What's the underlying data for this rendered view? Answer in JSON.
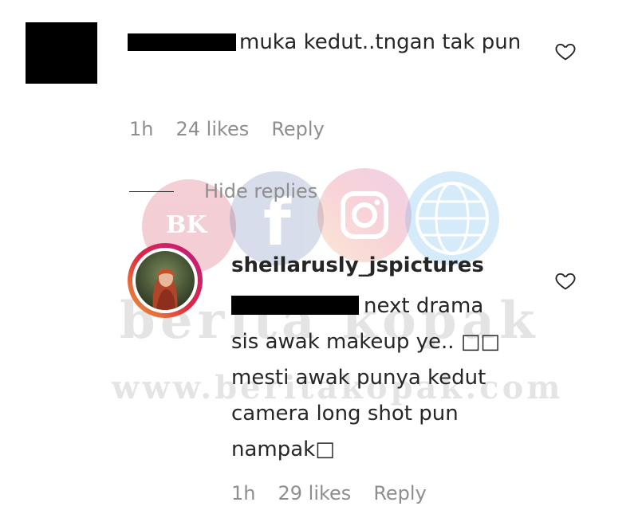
{
  "comment": {
    "text": "muka kedut..tngan tak pun",
    "time": "1h",
    "likes": "24 likes",
    "reply_label": "Reply"
  },
  "hide_replies_label": "Hide replies",
  "reply": {
    "username": "sheilarusly_jspictures",
    "text_lines": [
      "next drama",
      "sis awak makeup ye.. □□",
      "mesti awak punya kedut",
      "camera long shot pun",
      "nampak□"
    ],
    "time": "1h",
    "likes": "29 likes",
    "reply_label": "Reply"
  },
  "watermark": {
    "badge_text": "BK",
    "brand": "berita kopak",
    "url": "www.beritakopak.com"
  },
  "colors": {
    "text": "#262626",
    "meta": "#8e8e8e",
    "story_ring_start": "#f09433",
    "story_ring_end": "#bc1888"
  },
  "icons": [
    "heart-icon",
    "facebook-icon",
    "instagram-icon",
    "globe-icon"
  ]
}
